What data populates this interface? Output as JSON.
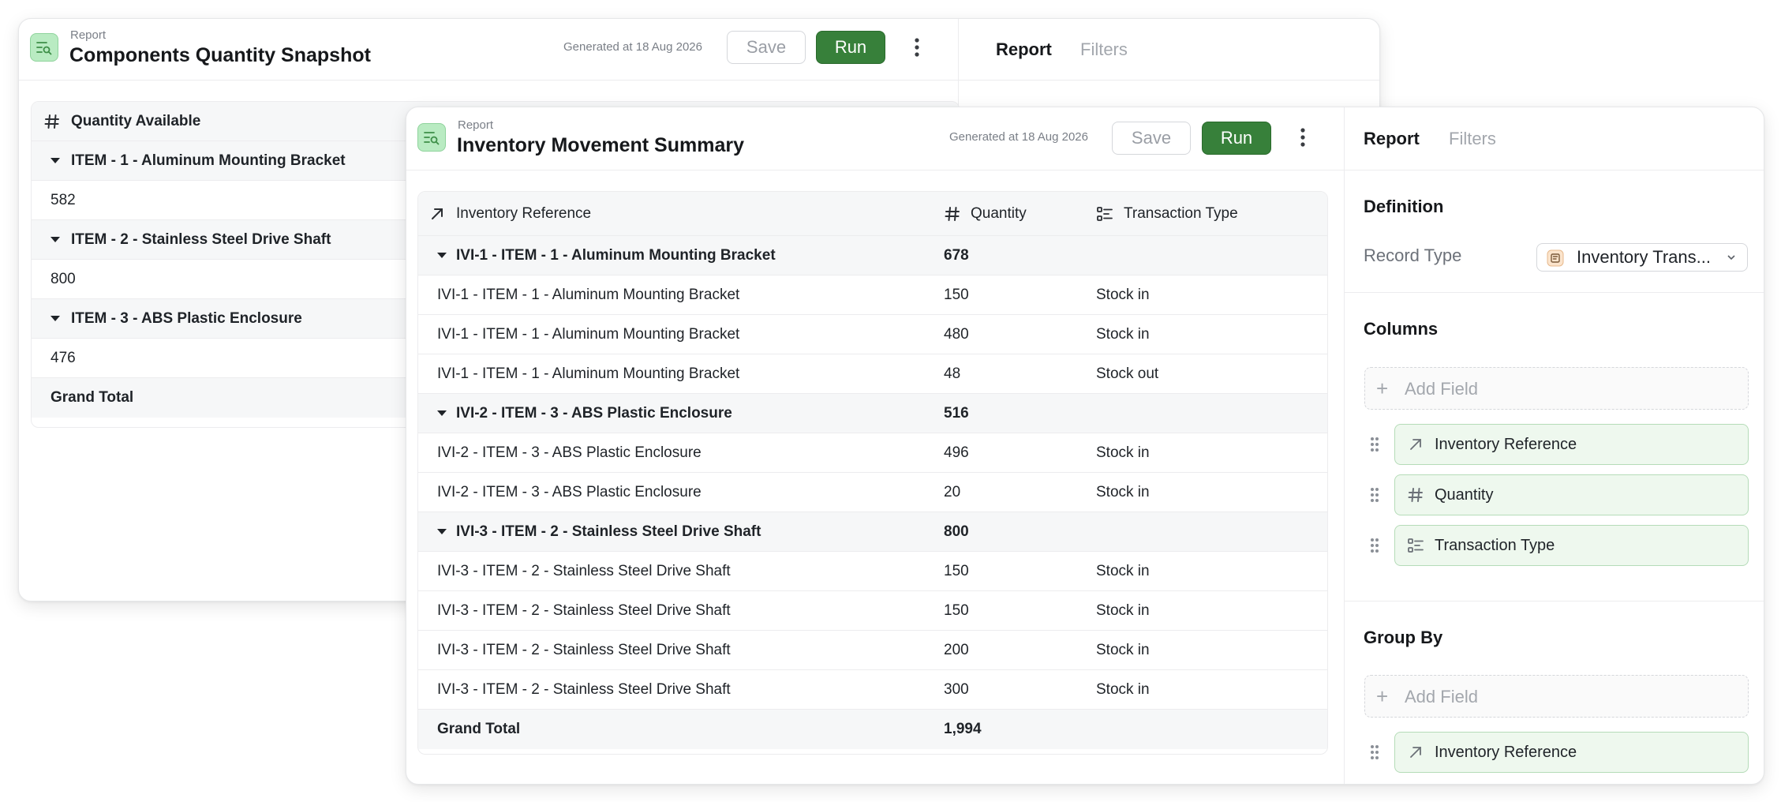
{
  "colors": {
    "run_green": "#37803a",
    "icon_bg": "#b9ebc2",
    "chip_bg": "#eef8ee"
  },
  "back_window": {
    "kicker": "Report",
    "title": "Components Quantity Snapshot",
    "generated": "Generated at 18 Aug 2026",
    "save_label": "Save",
    "run_label": "Run",
    "tabs": [
      "Report",
      "Filters"
    ],
    "table": {
      "header": "Quantity Available",
      "groups": [
        {
          "label": "ITEM - 1 - Aluminum Mounting Bracket",
          "value": "582"
        },
        {
          "label": "ITEM - 2 - Stainless Steel Drive Shaft",
          "value": "800"
        },
        {
          "label": "ITEM - 3 - ABS Plastic Enclosure",
          "value": "476"
        }
      ],
      "grand_total_label": "Grand Total"
    }
  },
  "front_window": {
    "kicker": "Report",
    "title": "Inventory Movement Summary",
    "generated": "Generated at 18 Aug 2026",
    "save_label": "Save",
    "run_label": "Run",
    "tabs": [
      "Report",
      "Filters"
    ],
    "table": {
      "columns": [
        "Inventory Reference",
        "Quantity",
        "Transaction Type"
      ],
      "rows": [
        {
          "group": true,
          "ref": "IVI-1 - ITEM - 1 - Aluminum Mounting Bracket",
          "qty": "678",
          "type": ""
        },
        {
          "group": false,
          "ref": "IVI-1 - ITEM - 1 - Aluminum Mounting Bracket",
          "qty": "150",
          "type": "Stock in"
        },
        {
          "group": false,
          "ref": "IVI-1 - ITEM - 1 - Aluminum Mounting Bracket",
          "qty": "480",
          "type": "Stock in"
        },
        {
          "group": false,
          "ref": "IVI-1 - ITEM - 1 - Aluminum Mounting Bracket",
          "qty": "48",
          "type": "Stock out"
        },
        {
          "group": true,
          "ref": "IVI-2 - ITEM - 3 - ABS Plastic Enclosure",
          "qty": "516",
          "type": ""
        },
        {
          "group": false,
          "ref": "IVI-2 - ITEM - 3 - ABS Plastic Enclosure",
          "qty": "496",
          "type": "Stock in"
        },
        {
          "group": false,
          "ref": "IVI-2 - ITEM - 3 - ABS Plastic Enclosure",
          "qty": "20",
          "type": "Stock in"
        },
        {
          "group": true,
          "ref": "IVI-3 - ITEM - 2 - Stainless Steel Drive Shaft",
          "qty": "800",
          "type": ""
        },
        {
          "group": false,
          "ref": "IVI-3 - ITEM - 2 - Stainless Steel Drive Shaft",
          "qty": "150",
          "type": "Stock in"
        },
        {
          "group": false,
          "ref": "IVI-3 - ITEM - 2 - Stainless Steel Drive Shaft",
          "qty": "150",
          "type": "Stock in"
        },
        {
          "group": false,
          "ref": "IVI-3 - ITEM - 2 - Stainless Steel Drive Shaft",
          "qty": "200",
          "type": "Stock in"
        },
        {
          "group": false,
          "ref": "IVI-3 - ITEM - 2 - Stainless Steel Drive Shaft",
          "qty": "300",
          "type": "Stock in"
        }
      ],
      "grand_total_label": "Grand Total",
      "grand_total_value": "1,994"
    },
    "panel": {
      "definition_title": "Definition",
      "record_type_label": "Record Type",
      "record_type_value": "Inventory Trans...",
      "columns_title": "Columns",
      "add_field_label": "Add Field",
      "column_fields": [
        "Inventory Reference",
        "Quantity",
        "Transaction Type"
      ],
      "group_by_title": "Group By",
      "group_by_fields": [
        "Inventory Reference"
      ]
    }
  }
}
